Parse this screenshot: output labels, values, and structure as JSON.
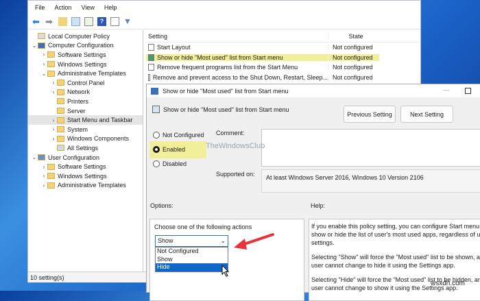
{
  "menu": [
    "File",
    "Action",
    "View",
    "Help"
  ],
  "tree": [
    {
      "label": "Local Computer Policy",
      "level": 0,
      "chev": "",
      "icon": "policy"
    },
    {
      "label": "Computer Configuration",
      "level": 0,
      "chev": "v",
      "icon": "computer"
    },
    {
      "label": "Software Settings",
      "level": 1,
      "chev": ">",
      "icon": "folder"
    },
    {
      "label": "Windows Settings",
      "level": 1,
      "chev": ">",
      "icon": "folder"
    },
    {
      "label": "Administrative Templates",
      "level": 1,
      "chev": "v",
      "icon": "folder"
    },
    {
      "label": "Control Panel",
      "level": 2,
      "chev": ">",
      "icon": "folder"
    },
    {
      "label": "Network",
      "level": 2,
      "chev": ">",
      "icon": "folder"
    },
    {
      "label": "Printers",
      "level": 2,
      "chev": "",
      "icon": "folder"
    },
    {
      "label": "Server",
      "level": 2,
      "chev": "",
      "icon": "folder"
    },
    {
      "label": "Start Menu and Taskbar",
      "level": 2,
      "chev": ">",
      "icon": "folder",
      "selected": true
    },
    {
      "label": "System",
      "level": 2,
      "chev": ">",
      "icon": "folder"
    },
    {
      "label": "Windows Components",
      "level": 2,
      "chev": ">",
      "icon": "folder"
    },
    {
      "label": "All Settings",
      "level": 2,
      "chev": "",
      "icon": "settings"
    },
    {
      "label": "User Configuration",
      "level": 0,
      "chev": "v",
      "icon": "user"
    },
    {
      "label": "Software Settings",
      "level": 1,
      "chev": ">",
      "icon": "folder"
    },
    {
      "label": "Windows Settings",
      "level": 1,
      "chev": ">",
      "icon": "folder"
    },
    {
      "label": "Administrative Templates",
      "level": 1,
      "chev": ">",
      "icon": "folder"
    }
  ],
  "status": "10 setting(s)",
  "list": {
    "col_setting": "Setting",
    "col_state": "State",
    "rows": [
      {
        "name": "Start Layout",
        "state": "Not configured"
      },
      {
        "name": "Show or hide \"Most used\" list from Start menu",
        "state": "Not configured",
        "highlight": true
      },
      {
        "name": "Remove frequent programs list from the Start Menu",
        "state": "Not configured"
      },
      {
        "name": "Remove and prevent access to the Shut Down, Restart, Sleep...",
        "state": "Not configured"
      }
    ]
  },
  "dialog": {
    "title": "Show or hide \"Most used\" list from Start menu",
    "heading": "Show or hide \"Most used\" list from Start menu",
    "prev": "Previous Setting",
    "next": "Next Setting",
    "radios": [
      "Not Configured",
      "Enabled",
      "Disabled"
    ],
    "selected_radio": "Enabled",
    "comment_label": "Comment:",
    "supported_label": "Supported on:",
    "supported_value": "At least Windows Server 2016, Windows 10 Version 2106",
    "options_label": "Options:",
    "help_label": "Help:",
    "choose_label": "Choose one of the following actions",
    "dropdown_value": "Show",
    "dropdown_options": [
      "Not Configured",
      "Show",
      "Hide"
    ],
    "help": [
      "If you enable this policy setting, you can configure Start menu to",
      "show or hide the list of user's most used apps, regardless of user",
      "settings.",
      "Selecting \"Show\" will force the \"Most used\" list to be shown, and",
      "user cannot change to hide it using the Settings app.",
      "Selecting \"Hide\" will force the \"Most used\" list to be hidden, and",
      "user cannot change to show it using the Settings app."
    ]
  },
  "watermark_club": "TheWindowsClub",
  "watermark_site": "wsxdn.com",
  "colors": {
    "highlight": "#f2ee9a",
    "arrow": "#e8333a",
    "selection": "#0f68c9"
  }
}
